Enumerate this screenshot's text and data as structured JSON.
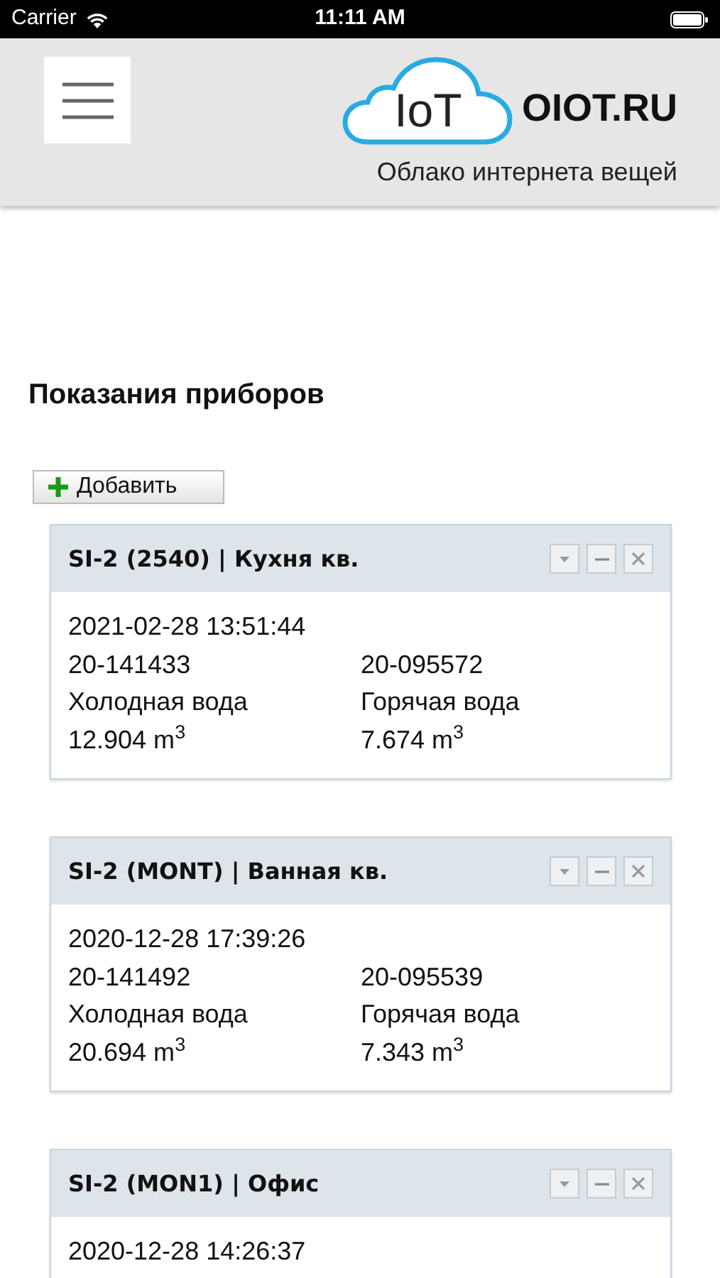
{
  "status_bar": {
    "carrier": "Carrier",
    "time": "11:11 AM"
  },
  "header": {
    "logo_mark": "IoT",
    "logo_text": "OIOT.RU",
    "tagline": "Облако интернета вещей"
  },
  "page_title": "Показания приборов",
  "add_button": "Добавить",
  "cards": [
    {
      "title": "SI-2 (2540) | Кухня кв.",
      "date": "2021-02-28 13:51:44",
      "meters": [
        {
          "serial": "20-141433",
          "name": "Холодная вода",
          "value": "12.904 m$^{3}$"
        },
        {
          "serial": "20-095572",
          "name": "Горячая вода",
          "value": "7.674 m$^{3}$"
        }
      ]
    },
    {
      "title": "SI-2 (MONT) | Ванная кв.",
      "date": "2020-12-28 17:39:26",
      "meters": [
        {
          "serial": "20-141492",
          "name": "Холодная вода",
          "value": "20.694 m$^{3}$"
        },
        {
          "serial": "20-095539",
          "name": "Горячая вода",
          "value": "7.343 m$^{3}$"
        }
      ]
    },
    {
      "title": "SI-2 (MON1) | Офис",
      "date": "2020-12-28 14:26:37"
    }
  ]
}
